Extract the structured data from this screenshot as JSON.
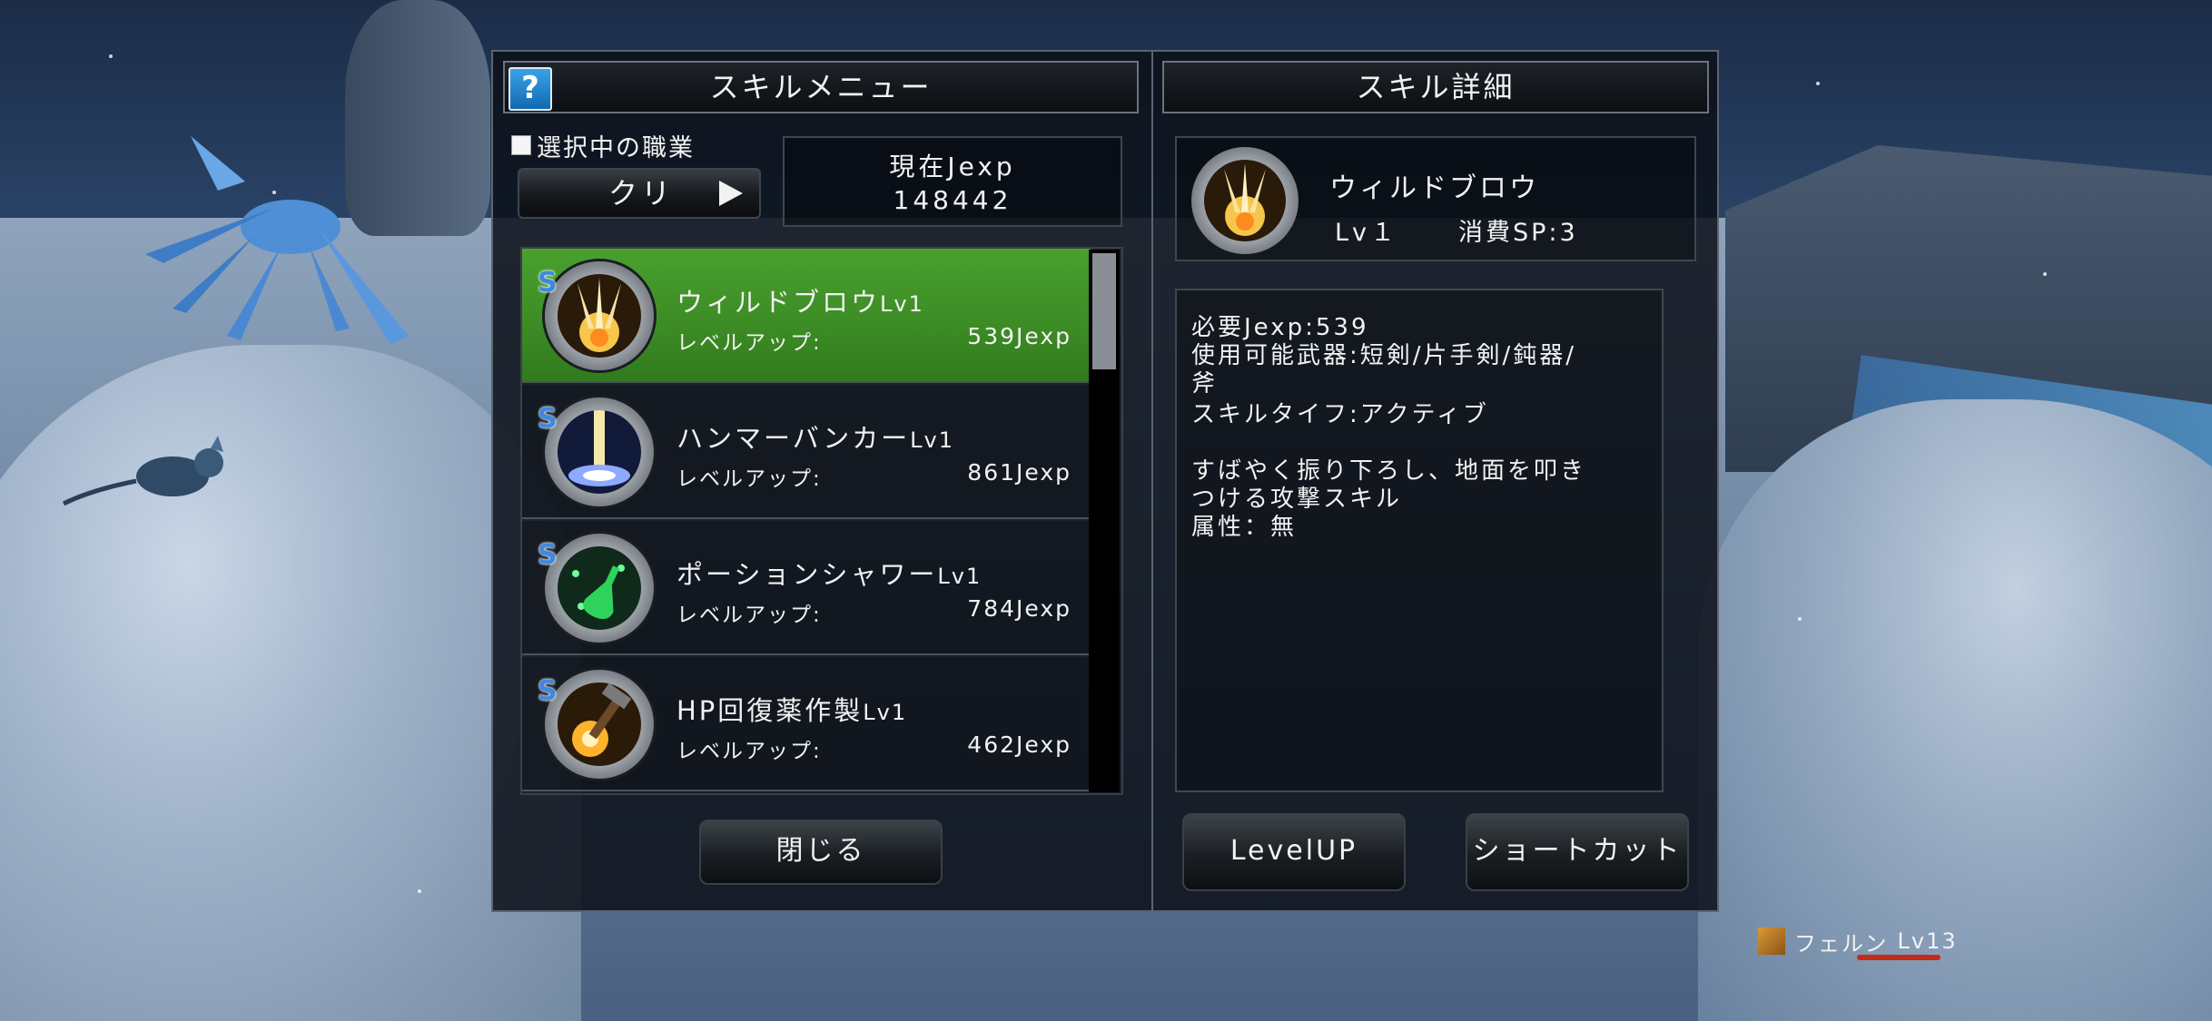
{
  "left_panel": {
    "title": "スキルメニュー",
    "help_label": "?",
    "checkbox_label": "選択中の職業",
    "job_button_label": "クリ",
    "jexp_title": "現在Jexp",
    "jexp_value": "148442",
    "close_label": "閉じる"
  },
  "skills": [
    {
      "name": "ウィルドブロウ",
      "level": "Lv1",
      "sub_label": "レベルアップ:",
      "cost": "539Jexp",
      "badge": "S",
      "selected": true
    },
    {
      "name": "ハンマーバンカー",
      "level": "Lv1",
      "sub_label": "レベルアップ:",
      "cost": "861Jexp",
      "badge": "S",
      "selected": false
    },
    {
      "name": "ポーションシャワー",
      "level": "Lv1",
      "sub_label": "レベルアップ:",
      "cost": "784Jexp",
      "badge": "S",
      "selected": false
    },
    {
      "name": "HP回復薬作製",
      "level": "Lv1",
      "sub_label": "レベルアップ:",
      "cost": "462Jexp",
      "badge": "S",
      "selected": false
    }
  ],
  "right_panel": {
    "title": "スキル詳細",
    "skill_name": "ウィルドブロウ",
    "skill_level": "Lv１",
    "skill_sp": "消費SP:3",
    "details": [
      "必要Jexp:539",
      "使用可能武器:短剣/片手剣/鈍器/",
      "斧",
      "スキルタイフ:アクティブ",
      "",
      "すばやく振り下ろし、地面を叩き",
      "つける攻撃スキル",
      "属性：無"
    ],
    "levelup_label": "LevelUP",
    "shortcut_label": "ショートカット"
  },
  "hud": {
    "player_name": "フェルン",
    "player_level": "Lv13"
  },
  "colors": {
    "selected_row": "#3c8b25",
    "panel_bg": "#0c1018",
    "help_button": "#1f86d0",
    "hp_bar": "#c32a18"
  }
}
